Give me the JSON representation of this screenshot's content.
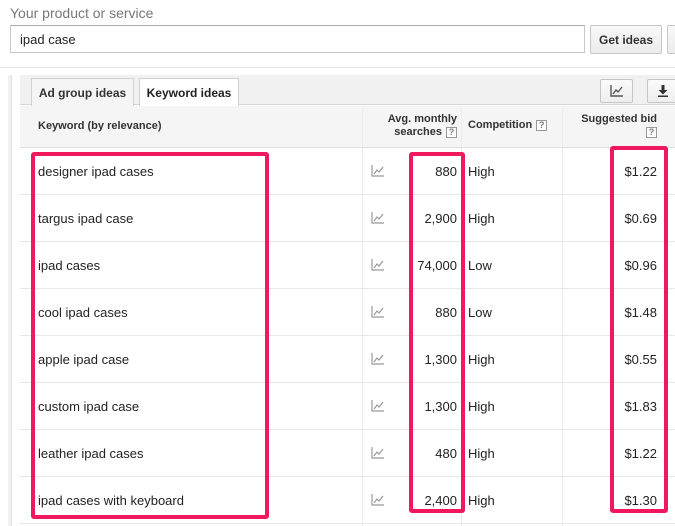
{
  "search": {
    "label": "Your product or service",
    "value": "ipad case",
    "get_ideas_label": "Get ideas"
  },
  "tabs": [
    {
      "label": "Ad group ideas",
      "active": false
    },
    {
      "label": "Keyword ideas",
      "active": true
    }
  ],
  "table": {
    "headers": {
      "keyword": "Keyword (by relevance)",
      "avg_line1": "Avg. monthly",
      "avg_line2": "searches",
      "competition": "Competition",
      "bid": "Suggested bid",
      "help": "?"
    },
    "rows": [
      {
        "keyword": "designer ipad cases",
        "searches": "880",
        "competition": "High",
        "bid": "$1.22"
      },
      {
        "keyword": "targus ipad case",
        "searches": "2,900",
        "competition": "High",
        "bid": "$0.69"
      },
      {
        "keyword": "ipad cases",
        "searches": "74,000",
        "competition": "Low",
        "bid": "$0.96"
      },
      {
        "keyword": "cool ipad cases",
        "searches": "880",
        "competition": "Low",
        "bid": "$1.48"
      },
      {
        "keyword": "apple ipad case",
        "searches": "1,300",
        "competition": "High",
        "bid": "$0.55"
      },
      {
        "keyword": "custom ipad case",
        "searches": "1,300",
        "competition": "High",
        "bid": "$1.83"
      },
      {
        "keyword": "leather ipad cases",
        "searches": "480",
        "competition": "High",
        "bid": "$1.22"
      },
      {
        "keyword": "ipad cases with keyboard",
        "searches": "2,400",
        "competition": "High",
        "bid": "$1.30"
      }
    ]
  },
  "icons": {
    "trend": "trend-chart-icon",
    "chart_tool": "line-chart-icon",
    "download_tool": "download-icon"
  },
  "colors": {
    "highlight": "#f0195d",
    "header_bg": "#f5f5f5",
    "tab_bar_bg": "#f1f1f1"
  }
}
